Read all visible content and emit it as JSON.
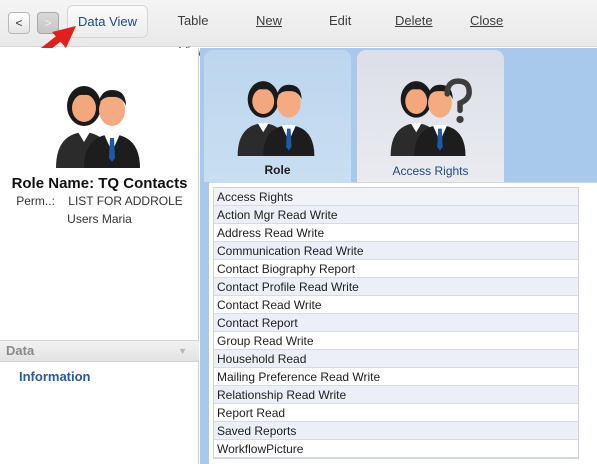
{
  "toolbar": {
    "back_label": "<",
    "forward_label": ">",
    "data_view": "Data View",
    "table_view": "Table View",
    "new": "New",
    "edit": "Edit",
    "delete": "Delete",
    "close": "Close"
  },
  "left_panel": {
    "role_name": "Role Name: TQ Contacts",
    "perm_label": "Perm..:",
    "perm_value": "LIST FOR ADDROLE",
    "users": "Users Maria",
    "section_header": "Data",
    "section_link": "Information"
  },
  "tabs": [
    {
      "label": "Role",
      "selected": false
    },
    {
      "label": "Access Rights",
      "selected": true
    }
  ],
  "access_list": {
    "header": "Access Rights",
    "rows": [
      "Action Mgr Read Write",
      "Address Read Write",
      "Communication Read Write",
      "Contact Biography Report",
      "Contact Profile Read Write",
      "Contact Read Write",
      "Contact Report",
      "Group Read Write",
      "Household Read",
      "Mailing Preference Read Write",
      "Relationship Read Write",
      "Report Read",
      "Saved Reports",
      "WorkflowPicture"
    ]
  },
  "colors": {
    "accent_blue": "#2a5b9a",
    "panel_blue": "#a9c9ec",
    "arrow_red": "#e0201c"
  },
  "icons": [
    "back-arrow-icon",
    "forward-arrow-icon",
    "role-users-icon",
    "access-rights-icon",
    "chevron-down-icon"
  ]
}
